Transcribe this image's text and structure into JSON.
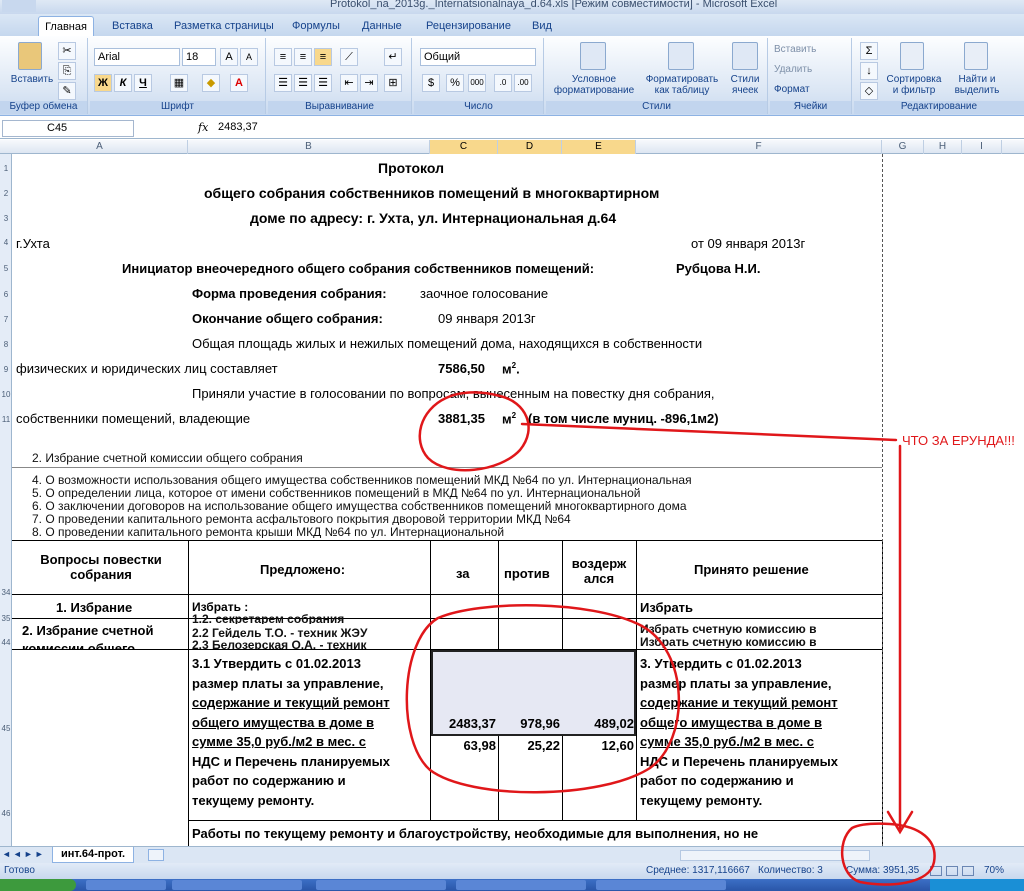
{
  "window": {
    "title": "Protokol_na_2013g._Internatsionalnaya_d.64.xls  [Режим совместимости] - Microsoft Excel"
  },
  "ribbon": {
    "tabs": [
      "Главная",
      "Вставка",
      "Разметка страницы",
      "Формулы",
      "Данные",
      "Рецензирование",
      "Вид"
    ],
    "clipboard": {
      "paste": "Вставить",
      "label": "Буфер обмена"
    },
    "font": {
      "name": "Arial",
      "size": "18",
      "bold": "Ж",
      "italic": "К",
      "underline": "Ч",
      "label": "Шрифт"
    },
    "alignment": {
      "label": "Выравнивание"
    },
    "number": {
      "format": "Общий",
      "label": "Число"
    },
    "styles": {
      "conditional": "Условное форматирование",
      "as_table": "Форматировать как таблицу",
      "cell_styles": "Стили ячеек",
      "label": "Стили"
    },
    "cells": {
      "insert": "Вставить",
      "delete": "Удалить",
      "format": "Формат",
      "label": "Ячейки"
    },
    "editing": {
      "sort": "Сортировка и фильтр",
      "find": "Найти и выделить",
      "label": "Редактирование"
    }
  },
  "formula_bar": {
    "name_box": "C45",
    "fx": "fx",
    "value": "2483,37"
  },
  "columns": [
    "A",
    "B",
    "C",
    "D",
    "E",
    "F",
    "G",
    "H",
    "I"
  ],
  "rows": [
    "1",
    "2",
    "3",
    "4",
    "5",
    "6",
    "7",
    "8",
    "9",
    "10",
    "11",
    "34",
    "35",
    "44",
    "45",
    "46"
  ],
  "document": {
    "title1": "Протокол",
    "title2": "общего собрания собственников помещений в многоквартирном",
    "title3": "доме по адресу: г. Ухта, ул. Интернациональная д.64",
    "city": "г.Ухта",
    "date": "от  09 января 2013г",
    "initiator_label": "Инициатор внеочередного общего собрания собственников помещений:",
    "initiator_name": "Рубцова Н.И.",
    "form_label": "Форма проведения собрания:",
    "form_value": "заочное голосование",
    "end_label": "Окончание общего собрания:",
    "end_value": "09 января 2013г",
    "area_text1": "Общая  площадь  жилых  и  нежилых  помещений  дома,  находящихся  в  собственности",
    "area_text2": "физических  и юридических  лиц  составляет",
    "area_value": "7586,50",
    "area_unit": "м",
    "participation1": "Приняли  участие  в  голосовании  по  вопросам,  вынесенным  на повестку дня собрания,",
    "participation2a": "собственники      помещений,      владеющие",
    "participation_value": "3881,35",
    "participation_unit": "м",
    "participation_note": "(в том числе муниц. -896,1м2)",
    "sup2": "2"
  },
  "garbled_lines": [
    "2. Избрание счетной комиссии общего собрания",
    "4. О возможности использования общего имущества собственников помещений МКД №64 по ул. Интернациональная",
    "5. О определении лица, которое от имени собственников помещений в МКД №64 по ул. Интернациональной",
    "6. О заключении договоров на использование общего имущества собственников помещений многоквартирного дома",
    "7. О проведении капитального ремонта асфальтового покрытия дворовой территории МКД №64",
    "8. О проведении капитального ремонта крыши МКД №64 по ул. Интернациональной"
  ],
  "table": {
    "h_questions": "Вопросы повестки собрания",
    "h_proposed": "Предложено:",
    "h_for": "за",
    "h_against": "против",
    "h_abstain": "воздерж ался",
    "h_decision": "Принято решение",
    "row1_q": "1. Избрание",
    "row1_p": "Избрать :",
    "row1_d": "Избрать",
    "row2_q": "2. Избрание счетной комиссии общего",
    "row2_p1": "1.2. секретарем собрания",
    "row2_p2": "2.2 Гейдель Т.О. - техник ЖЭУ",
    "row2_p3": "2.3 Белозерская О.А. - техник",
    "row2_d": "Избрать счетную комиссию в",
    "row3_p": [
      "3.1 Утвердить с 01.02.2013",
      "размер платы за управление,",
      "содержание и текущий ремонт",
      "общего имущества в доме в",
      "сумме 35,0 руб./м2 в мес. с",
      "НДС и Перечень планируемых",
      "работ по содержанию и",
      "текущему ремонту."
    ],
    "row3_d": [
      "3. Утвердить с 01.02.2013",
      "размер платы за управление,",
      "содержание и текущий ремонт",
      "общего имущества в доме в",
      "сумме 35,0 руб./м2 в мес. с",
      "НДС и Перечень планируемых",
      "работ по содержанию и",
      "текущему ремонту."
    ],
    "votes_sq": [
      "2483,37",
      "978,96",
      "489,02"
    ],
    "votes_pct": [
      "63,98",
      "25,22",
      "12,60"
    ],
    "row4": "Работы по текущему ремонту и благоустройству, необходимые для выполнения, но не"
  },
  "sheet_tab": "инт.64-прот.",
  "status": {
    "ready": "Готово",
    "average": "Среднее: 1317,116667",
    "count": "Количество: 3",
    "sum": "Сумма: 3951,35",
    "zoom": "70%"
  },
  "annotation": {
    "text": "ЧТО ЗА ЕРУНДА!!!",
    "color": "#e0171a"
  }
}
